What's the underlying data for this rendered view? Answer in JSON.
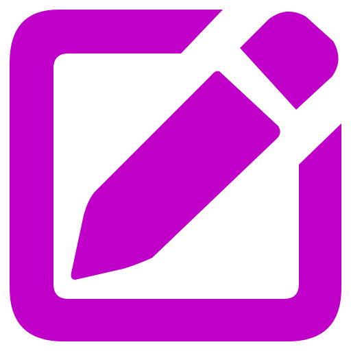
{
  "icon": {
    "name": "edit-icon",
    "color": "#c000c8",
    "background": "#ffffff"
  }
}
